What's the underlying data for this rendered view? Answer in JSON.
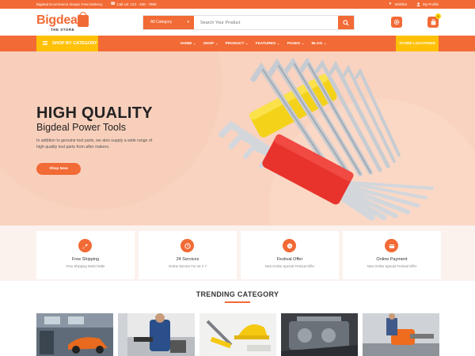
{
  "topbar": {
    "tagline": "Bigdeal Ecommerce Always Free Delivery",
    "phone": "Call Us: 123 - 456 - 7890",
    "wishlist": "Wishlist",
    "profile": "My Profile"
  },
  "header": {
    "logo_text": "Bigdeal",
    "logo_sub": "THE STORE",
    "category_label": "All Category",
    "search_placeholder": "Search Your Product",
    "cart_count": "0"
  },
  "nav": {
    "shop_by_category": "SHOP BY CATEGORY",
    "menu": [
      "HOME",
      "SHOP",
      "PRODUCT",
      "FEATURES",
      "PAGES",
      "BLOG"
    ],
    "store_locations": "STORE LOCATIONS"
  },
  "hero": {
    "title": "HIGH QUALITY",
    "subtitle": "Bigdeal Power Tools",
    "description": "In addition to genuine tool parts, we also supply a wide range of high quality tool parts from after makers.",
    "button": "Shop Now"
  },
  "features": [
    {
      "title": "Free Shipping",
      "desc": "Free Shipping World Wide",
      "icon": "rocket-icon"
    },
    {
      "title": "24 Services",
      "desc": "Online Service For 24 X 7",
      "icon": "clock-icon"
    },
    {
      "title": "Festival Offer",
      "desc": "New Online Special Festival Offer",
      "icon": "offer-icon"
    },
    {
      "title": "Online Payment",
      "desc": "New Online Special Festival Offer",
      "icon": "payment-icon"
    }
  ],
  "trending": {
    "title": "TRENDING CATEGORY",
    "tiles": [
      "garage-image",
      "mechanic-image",
      "helmet-tools-image",
      "engine-image",
      "chainsaw-image"
    ]
  },
  "colors": {
    "accent": "#f26a35",
    "secondary": "#ffc107",
    "hero_bg": "#f9d3c0"
  }
}
